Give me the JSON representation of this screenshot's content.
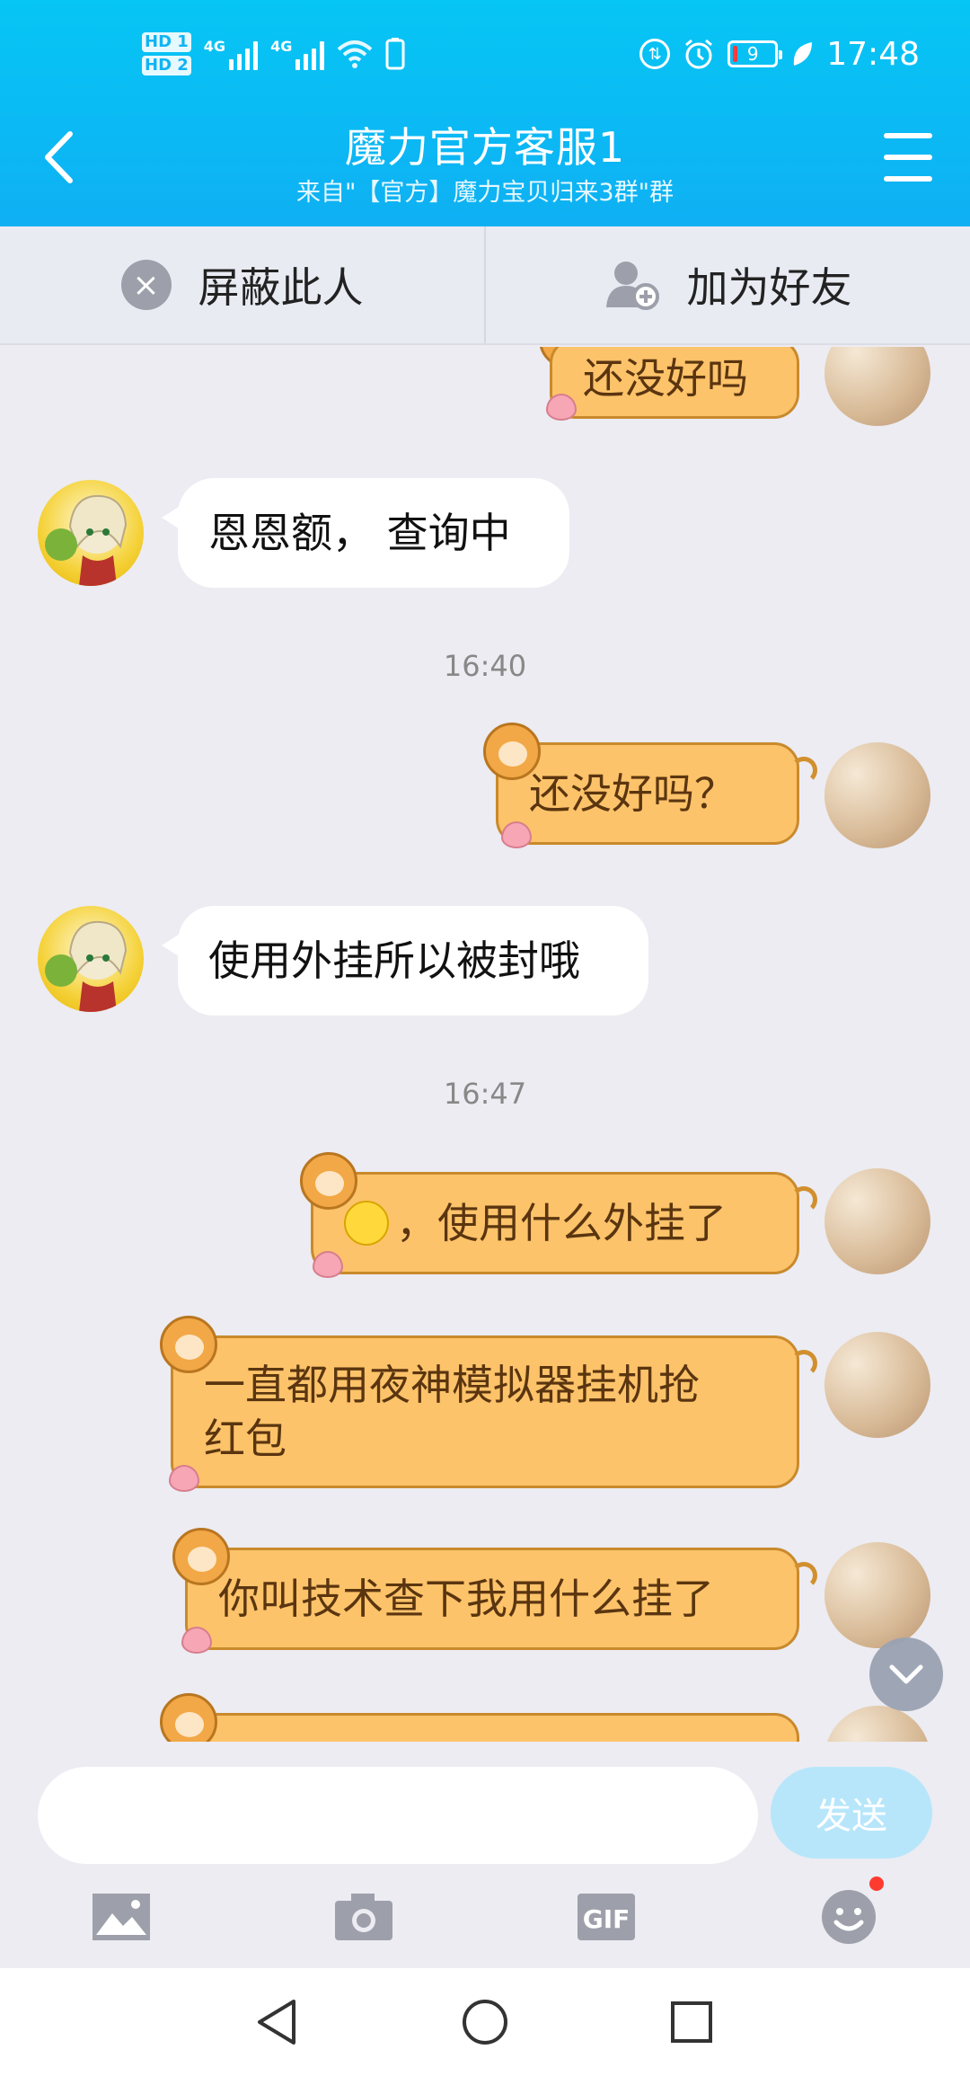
{
  "status_bar": {
    "time": "17:48",
    "battery": "9",
    "hd1": "HD 1",
    "hd2": "HD 2",
    "net1": "4G",
    "net2": "4G"
  },
  "header": {
    "title": "魔力官方客服1",
    "subtitle": "来自\"【官方】魔力宝贝归来3群\"群"
  },
  "actions": {
    "block_label": "屏蔽此人",
    "add_friend_label": "加为好友"
  },
  "messages": [
    {
      "sender": "me",
      "text": "还没好吗"
    },
    {
      "sender": "them",
      "text": "恩恩额， 查询中"
    },
    {
      "type": "time",
      "text": "16:40"
    },
    {
      "sender": "me",
      "text": "还没好吗？"
    },
    {
      "sender": "them",
      "text": "使用外挂所以被封哦"
    },
    {
      "type": "time",
      "text": "16:47"
    },
    {
      "sender": "me",
      "text": "，使用什么外挂了",
      "emoji": "dizzy-face"
    },
    {
      "sender": "me",
      "text_line1": "一直都用夜神模拟器挂机抢",
      "text_line2": "红包"
    },
    {
      "sender": "me",
      "text": "你叫技术查下我用什么挂了"
    }
  ],
  "composer": {
    "placeholder": "",
    "send_label": "发送"
  },
  "toolbar_icons": [
    "image-icon",
    "camera-icon",
    "gif-icon",
    "emoji-icon"
  ],
  "gif_label": "GIF",
  "colors": {
    "header": "#0fb0f3",
    "my_bubble": "#fdc36a",
    "send_button": "#b7e6fb"
  }
}
